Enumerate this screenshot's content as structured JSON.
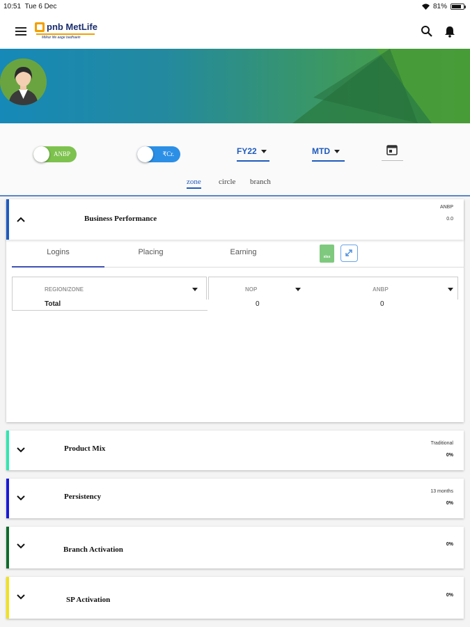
{
  "status": {
    "time": "10:51",
    "date": "Tue 6 Dec",
    "battery": "81%",
    "battery_fraction": 0.81
  },
  "header": {
    "logo_name": "pnb MetLife",
    "logo_tagline": "Milkar life aage badhaein"
  },
  "filters": {
    "toggle_anbp": "ANBP",
    "toggle_cr": "₹Cr.",
    "fy": "FY22",
    "period": "MTD"
  },
  "segments": [
    {
      "label": "zone",
      "active": true
    },
    {
      "label": "circle",
      "active": false
    },
    {
      "label": "branch",
      "active": false
    }
  ],
  "business_performance": {
    "title": "Business Performance",
    "meta_label": "ANBP",
    "meta_value": "0.0",
    "tabs": [
      "Logins",
      "Placing",
      "Earning"
    ],
    "active_tab": "Logins",
    "xls_label": "xlsx",
    "columns": [
      "REGION/ZONE",
      "NOP",
      "ANBP"
    ],
    "rows": [
      {
        "region": "Total",
        "nop": "0",
        "anbp": "0"
      }
    ]
  },
  "sections": {
    "product_mix": {
      "title": "Product Mix",
      "meta_label": "Traditional",
      "value": "0%",
      "accent": "#2ee8b0"
    },
    "persistency": {
      "title": "Persistency",
      "meta_label": "13 months",
      "value": "0%",
      "accent": "#1a1ad6"
    },
    "branch_activation": {
      "title": "Branch Activation",
      "value": "0%",
      "accent": "#0d6b2b"
    },
    "sp_activation": {
      "title": "SP Activation",
      "value": "0%",
      "accent": "#f2e21a"
    }
  },
  "colors": {
    "primary": "#1f5bbd",
    "banner_start": "#1689b8",
    "banner_end": "#4ea337",
    "toggle_green": "#7dc24e",
    "toggle_blue": "#2c8fe6"
  }
}
